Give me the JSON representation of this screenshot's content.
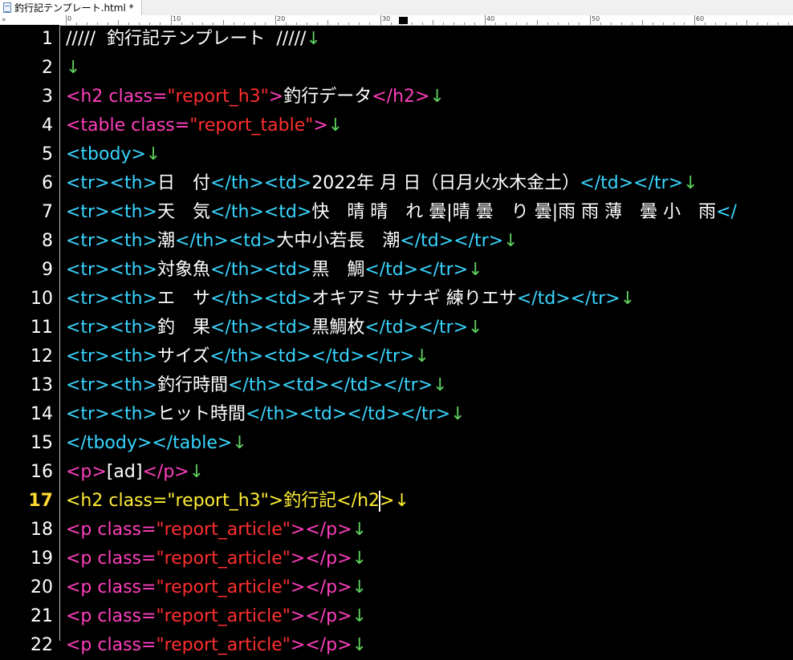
{
  "tab": {
    "title": "釣行記テンプレート.html *"
  },
  "ruler": {
    "labels": [
      "0",
      "10",
      "20",
      "30",
      "40",
      "50",
      "60"
    ]
  },
  "newline_mark": "↓",
  "lines": [
    {
      "n": "1",
      "t1": "/////  釣行記テンプレート  /////"
    },
    {
      "n": "2"
    },
    {
      "n": "3",
      "t1": "<h2 class=",
      "t2": "\"report_h3\"",
      "t3": ">",
      "t4": "釣行データ",
      "t5": "</h2>"
    },
    {
      "n": "4",
      "t1": "<table class=",
      "t2": "\"report_table\"",
      "t3": ">"
    },
    {
      "n": "5",
      "t1": "<tbody>"
    },
    {
      "n": "6",
      "t1": "<tr><th>",
      "t2": "日　付",
      "t3": "</th><td>",
      "t4": "2022年 月 日（日月火水木金土）",
      "t5": "</td></tr>"
    },
    {
      "n": "7",
      "t1": "<tr><th>",
      "t2": "天　気",
      "t3": "</th><td>",
      "t4": "快　晴 晴　れ 曇|晴 曇　り 曇|雨 雨 薄　曇 小　雨",
      "t5": "</"
    },
    {
      "n": "8",
      "t1": "<tr><th>",
      "t2": "潮",
      "t3": "</th><td>",
      "t4": "大中小若長　潮",
      "t5": "</td></tr>"
    },
    {
      "n": "9",
      "t1": "<tr><th>",
      "t2": "対象魚",
      "t3": "</th><td>",
      "t4": "黒　鯛",
      "t5": "</td></tr>"
    },
    {
      "n": "10",
      "t1": "<tr><th>",
      "t2": "エ　サ",
      "t3": "</th><td>",
      "t4": "オキアミ サナギ 練りエサ",
      "t5": "</td></tr>"
    },
    {
      "n": "11",
      "t1": "<tr><th>",
      "t2": "釣　果",
      "t3": "</th><td>",
      "t4": "黒鯛枚",
      "t5": "</td></tr>"
    },
    {
      "n": "12",
      "t1": "<tr><th>",
      "t2": "サイズ",
      "t3": "</th><td>",
      "t4": "",
      "t5": "</td></tr>"
    },
    {
      "n": "13",
      "t1": "<tr><th>",
      "t2": "釣行時間",
      "t3": "</th><td>",
      "t4": "",
      "t5": "</td></tr>"
    },
    {
      "n": "14",
      "t1": "<tr><th>",
      "t2": "ヒット時間",
      "t3": "</th><td>",
      "t4": "",
      "t5": "</td></tr>"
    },
    {
      "n": "15",
      "t1": "</tbody></table>"
    },
    {
      "n": "16",
      "t1": "<p>",
      "t2": "[ad]",
      "t3": "</p>"
    },
    {
      "n": "17",
      "t1": "<h2 class=\"report_h3\">釣行記</h2",
      "t2": ">"
    },
    {
      "n": "18",
      "t1": "<p class=",
      "t2": "\"report_article\"",
      "t3": "></p>"
    },
    {
      "n": "19",
      "t1": "<p class=",
      "t2": "\"report_article\"",
      "t3": "></p>"
    },
    {
      "n": "20",
      "t1": "<p class=",
      "t2": "\"report_article\"",
      "t3": "></p>"
    },
    {
      "n": "21",
      "t1": "<p class=",
      "t2": "\"report_article\"",
      "t3": "></p>"
    },
    {
      "n": "22",
      "t1": "<p class=",
      "t2": "\"report_article\"",
      "t3": "></p>"
    }
  ],
  "colors": {
    "background": "#000000",
    "tag": "#ff3fbe",
    "table_tag": "#39d6ff",
    "attr_value": "#ff2f2f",
    "current_line": "#ffee33",
    "newline_mark": "#5ed05e"
  }
}
